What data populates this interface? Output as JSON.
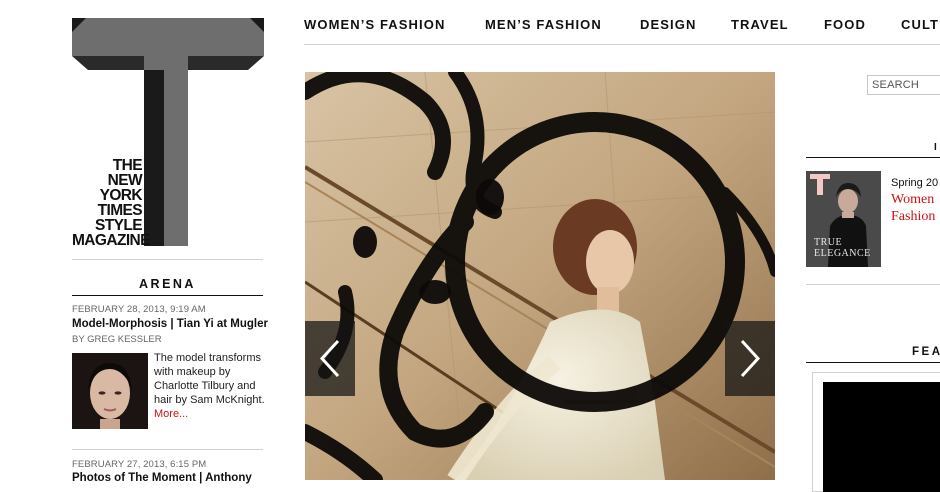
{
  "brand": {
    "logo_lines": [
      "The",
      "New York",
      "Times",
      "Style",
      "Magazine"
    ]
  },
  "nav": {
    "items": [
      "Women’s Fashion",
      "Men’s Fashion",
      "Design",
      "Travel",
      "Food",
      "Cult"
    ]
  },
  "search": {
    "placeholder": "SEARCH"
  },
  "left": {
    "section_title": "ARENA",
    "articles": [
      {
        "date": "FEBRUARY 28, 2013, 9:19 AM",
        "title": "Model-Morphosis | Tian Yi at Mugler",
        "byline": "By GREG KESSLER",
        "blurb": "The model transforms with makeup by Charlotte Tilbury and hair by Sam McKnight.",
        "more": "More..."
      },
      {
        "date": "FEBRUARY 27, 2013, 6:15 PM",
        "title": "Photos of The Moment | Anthony"
      }
    ]
  },
  "right": {
    "header_fragment": "I",
    "issue_label": "Spring 20",
    "issue_title_lines": [
      "Women",
      "Fashion"
    ],
    "cover_lines": [
      "TRUE",
      "ELEGANCE"
    ],
    "feature_heading": "FEA"
  },
  "colors": {
    "accent_red": "#cc1212",
    "logo_gray": "#6e6e6e",
    "logo_black": "#111111"
  }
}
